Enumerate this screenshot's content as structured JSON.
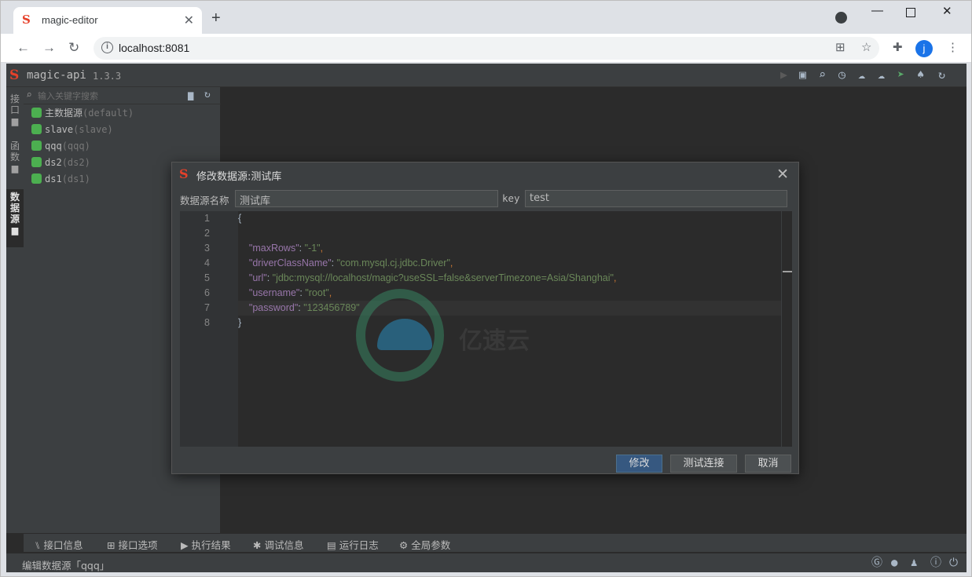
{
  "browser": {
    "tab_title": "magic-editor",
    "tab_close": "✕",
    "new_tab": "+",
    "url": "localhost:8081",
    "profile_initial": "j"
  },
  "app": {
    "name": "magic-api",
    "version": "1.3.3",
    "left_tabs": [
      "接口",
      "函数",
      "数据源"
    ],
    "search_placeholder": "输入关键字搜索",
    "datasources": [
      {
        "name": "主数据源",
        "key": "(default)"
      },
      {
        "name": "slave",
        "key": "(slave)"
      },
      {
        "name": "qqq",
        "key": "(qqq)"
      },
      {
        "name": "ds2",
        "key": "(ds2)"
      },
      {
        "name": "ds1",
        "key": "(ds1)"
      }
    ],
    "bottom_tabs": [
      "接口信息",
      "接口选项",
      "执行结果",
      "调试信息",
      "运行日志",
      "全局参数"
    ],
    "status_text": "编辑数据源「qqq」"
  },
  "dialog": {
    "title": "修改数据源:测试库",
    "name_label": "数据源名称",
    "name_value": "测试库",
    "key_label": "key",
    "key_value": "test",
    "line_numbers": [
      "1",
      "2",
      "3",
      "4",
      "5",
      "6",
      "7",
      "8"
    ],
    "code": {
      "open": "{",
      "close": "}",
      "maxRows_key": "\"maxRows\"",
      "maxRows_val": "\"-1\"",
      "driver_key": "\"driverClassName\"",
      "driver_val": "\"com.mysql.cj.jdbc.Driver\"",
      "url_key": "\"url\"",
      "url_val": "\"jdbc:mysql://localhost/magic?useSSL=false&serverTimezone=Asia/Shanghai\"",
      "user_key": "\"username\"",
      "user_val": "\"root\"",
      "pass_key": "\"password\"",
      "pass_val": "\"123456789\""
    },
    "buttons": {
      "save": "修改",
      "test": "测试连接",
      "cancel": "取消"
    }
  },
  "watermark_text": "亿速云"
}
